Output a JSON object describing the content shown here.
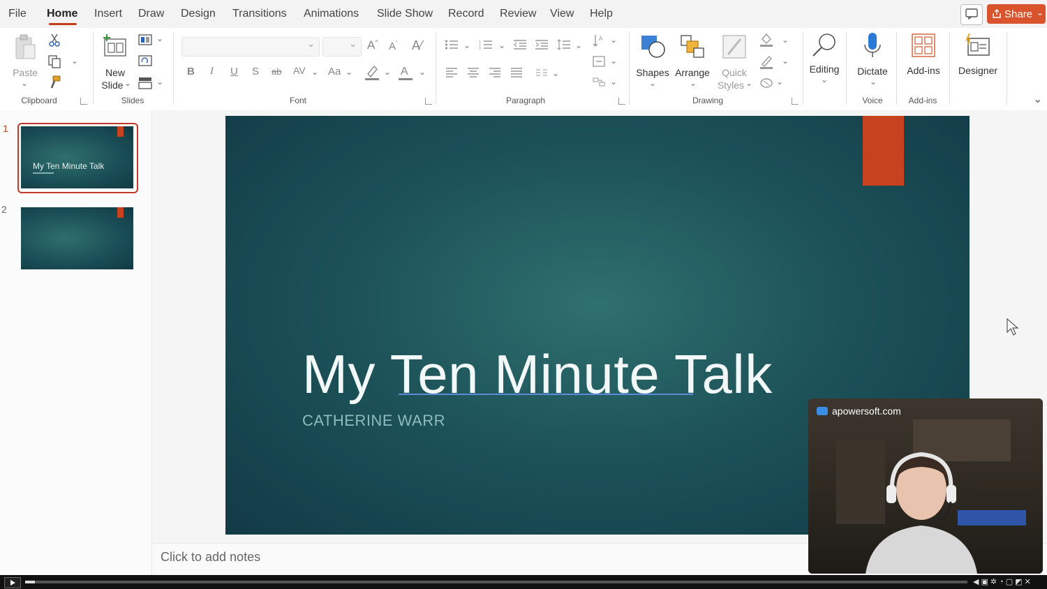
{
  "menu": {
    "file": "File",
    "home": "Home",
    "insert": "Insert",
    "draw": "Draw",
    "design": "Design",
    "transitions": "Transitions",
    "animations": "Animations",
    "slideshow": "Slide Show",
    "record": "Record",
    "review": "Review",
    "view": "View",
    "help": "Help"
  },
  "share_label": "Share",
  "ribbon": {
    "paste": "Paste",
    "new_slide_1": "New",
    "new_slide_2": "Slide",
    "shapes": "Shapes",
    "arrange": "Arrange",
    "quick_styles_1": "Quick",
    "quick_styles_2": "Styles",
    "editing": "Editing",
    "dictate": "Dictate",
    "addins": "Add-ins",
    "designer": "Designer",
    "groups": {
      "clipboard": "Clipboard",
      "slides": "Slides",
      "font": "Font",
      "paragraph": "Paragraph",
      "drawing": "Drawing",
      "voice": "Voice",
      "addins": "Add-ins"
    },
    "font_buttons": {
      "bold": "B",
      "italic": "I",
      "underline": "U",
      "strike": "S",
      "abc": "ab",
      "spacing": "AV",
      "case": "Aa"
    }
  },
  "thumbnails": [
    {
      "number": "1",
      "title": "My Ten Minute Talk"
    },
    {
      "number": "2"
    }
  ],
  "slide": {
    "title": "My Ten Minute Talk",
    "subtitle": "CATHERINE WARR"
  },
  "notes_placeholder": "Click to add notes",
  "webcam": {
    "brand": "apowersoft.com"
  },
  "player": {
    "progress": 0.01
  },
  "colors": {
    "accent": "#c43e1c",
    "share": "#d9532c",
    "slide_bg": "#1d5359",
    "slide_accent": "#c7421f"
  }
}
